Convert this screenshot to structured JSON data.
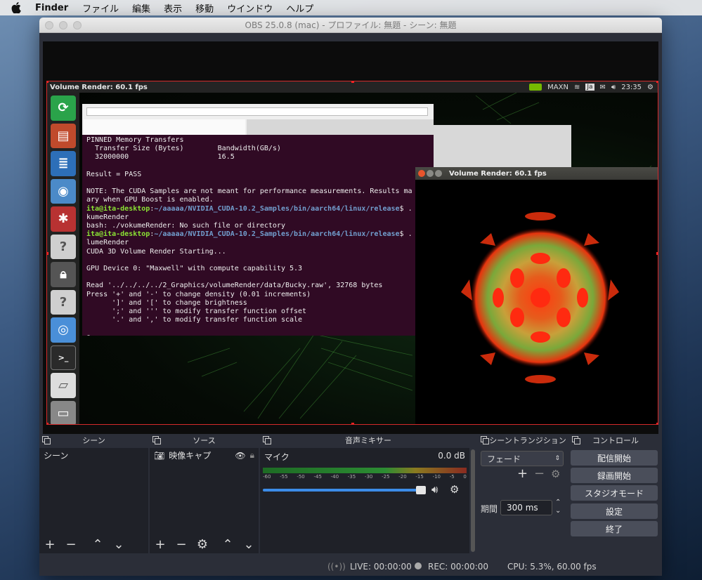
{
  "menubar": {
    "app": "Finder",
    "items": [
      "ファイル",
      "編集",
      "表示",
      "移動",
      "ウインドウ",
      "ヘルプ"
    ]
  },
  "window": {
    "title": "OBS 25.0.8 (mac) - プロファイル: 無題 - シーン: 無題"
  },
  "capture": {
    "ubuntu_title": "Volume Render: 60.1 fps",
    "tray": {
      "gpu_mode": "MAXN",
      "lang": "Ja",
      "clock": "23:35"
    },
    "terminal_lines": [
      {
        "t": "PINNED Memory Transfers",
        "c": "n"
      },
      {
        "t": "  Transfer Size (Bytes)        Bandwidth(GB/s)",
        "c": "n"
      },
      {
        "t": "  32000000                     16.5",
        "c": "n"
      },
      {
        "t": "",
        "c": "n"
      },
      {
        "t": "Result = PASS",
        "c": "n"
      },
      {
        "t": "",
        "c": "n"
      },
      {
        "t": "NOTE: The CUDA Samples are not meant for performance measurements. Results ma",
        "c": "n"
      },
      {
        "t": "ary when GPU Boost is enabled.",
        "c": "n"
      },
      {
        "t": "ita@ita-desktop:~/aaaaa/NVIDIA_CUDA-10.2_Samples/bin/aarch64/linux/release$ .",
        "c": "p"
      },
      {
        "t": "kumeRender",
        "c": "n"
      },
      {
        "t": "bash: ./vokumeRender: No such file or directory",
        "c": "n"
      },
      {
        "t": "ita@ita-desktop:~/aaaaa/NVIDIA_CUDA-10.2_Samples/bin/aarch64/linux/release$ .",
        "c": "p"
      },
      {
        "t": "lumeRender",
        "c": "n"
      },
      {
        "t": "CUDA 3D Volume Render Starting...",
        "c": "n"
      },
      {
        "t": "",
        "c": "n"
      },
      {
        "t": "GPU Device 0: \"Maxwell\" with compute capability 5.3",
        "c": "n"
      },
      {
        "t": "",
        "c": "n"
      },
      {
        "t": "Read '../../../../2_Graphics/volumeRender/data/Bucky.raw', 32768 bytes",
        "c": "n"
      },
      {
        "t": "Press '+' and '-' to change density (0.01 increments)",
        "c": "n"
      },
      {
        "t": "      ']' and '[' to change brightness",
        "c": "n"
      },
      {
        "t": "      ';' and ''' to modify transfer function offset",
        "c": "n"
      },
      {
        "t": "      '.' and ',' to modify transfer function scale",
        "c": "n"
      },
      {
        "t": "",
        "c": "n"
      },
      {
        "t": "▯",
        "c": "n"
      }
    ],
    "vr_window_title": "Volume Render: 60.1 fps"
  },
  "docks": {
    "scenes": {
      "title": "シーン",
      "items": [
        "シーン"
      ]
    },
    "sources": {
      "title": "ソース",
      "items": [
        "映像キャプ"
      ]
    },
    "mixer": {
      "title": "音声ミキサー",
      "track": "マイク",
      "level": "0.0 dB",
      "ticks": [
        "-60",
        "-55",
        "-50",
        "-45",
        "-40",
        "-35",
        "-30",
        "-25",
        "-20",
        "-15",
        "-10",
        "-5",
        "0"
      ]
    },
    "transitions": {
      "title": "シーントランジション",
      "type": "フェード",
      "duration_label": "期間",
      "duration": "300 ms"
    },
    "controls": {
      "title": "コントロール",
      "buttons": [
        "配信開始",
        "録画開始",
        "スタジオモード",
        "設定",
        "終了"
      ]
    }
  },
  "status": {
    "live": "LIVE: 00:00:00",
    "rec": "REC: 00:00:00",
    "cpu": "CPU: 5.3%, 60.00 fps"
  }
}
